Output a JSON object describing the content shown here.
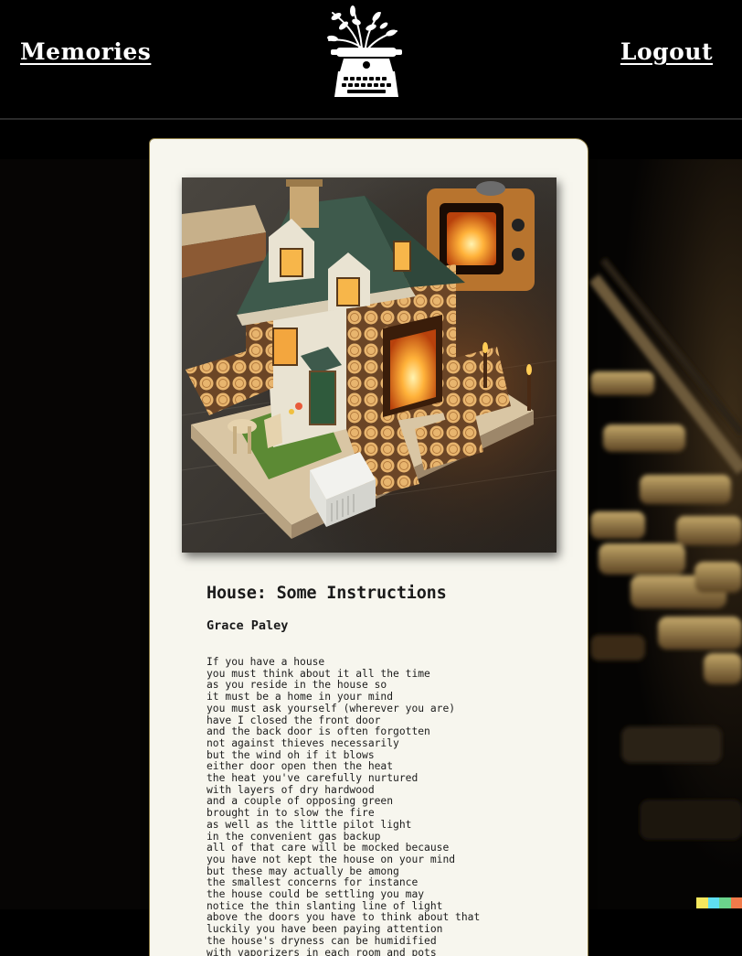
{
  "header": {
    "memories_label": "Memories",
    "logout_label": "Logout"
  },
  "icons": {
    "logo": "typewriter-logo-icon"
  },
  "colors": {
    "page_background": "#000000",
    "paper": "#f7f6ee",
    "paper_border": "#8d7d45",
    "text": "#1a1a1a",
    "swatch": [
      "#f5e85e",
      "#5fe0f2",
      "#6bd48c",
      "#f07a4a"
    ]
  },
  "poem": {
    "title": "House: Some Instructions",
    "author": "Grace Paley",
    "lines": [
      "If you have a house",
      "you must think about it all the time",
      "as you reside in the house so",
      "it must be a home in your mind",
      "you must ask yourself (wherever you are)",
      "have I closed the front door",
      "and the back door is often forgotten",
      "not against thieves necessarily",
      "but the wind oh if it blows",
      "either door open then the heat",
      "the heat you've carefully nurtured",
      "with layers of dry hardwood",
      "and a couple of opposing green",
      "brought in to slow the fire",
      "as well as the little pilot light",
      "in the convenient gas backup",
      "all of that care will be mocked because",
      "you have not kept the house on your mind",
      "but these may actually be among",
      "the smallest concerns for instance",
      "the house could be settling you may",
      "notice the thin slanting line of light",
      "above the doors you have to think about that",
      "luckily you have been paying attention",
      "the house's dryness can be humidified",
      "with vaporizers in each room and pots"
    ]
  }
}
